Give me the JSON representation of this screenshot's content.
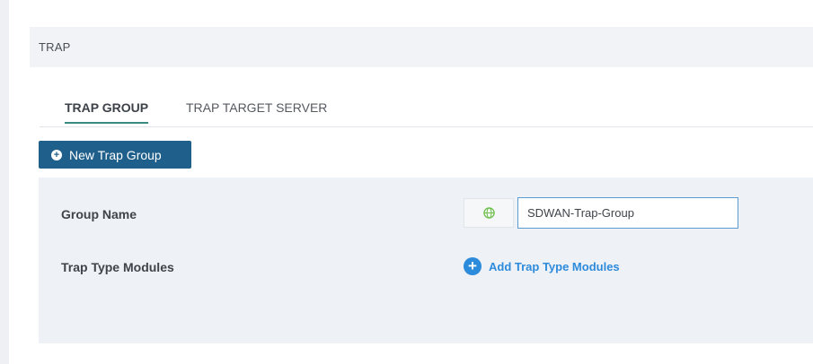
{
  "section": {
    "title": "TRAP"
  },
  "tabs": [
    {
      "label": "TRAP GROUP",
      "active": true
    },
    {
      "label": "TRAP TARGET SERVER",
      "active": false
    }
  ],
  "toolbar": {
    "new_label": "New Trap Group"
  },
  "form": {
    "group_name_label": "Group Name",
    "group_name_value": "SDWAN-Trap-Group",
    "trap_type_label": "Trap Type Modules",
    "add_modules_label": "Add Trap Type Modules"
  },
  "icons": {
    "language": "globe-icon",
    "add": "plus-circle-icon",
    "new": "plus-circle-icon"
  },
  "colors": {
    "primary_button": "#1f5f8b",
    "tab_underline": "#3b8a7f",
    "link": "#2d8bdc",
    "input_border": "#5b9bd0",
    "panel_bg": "#eef1f5"
  }
}
